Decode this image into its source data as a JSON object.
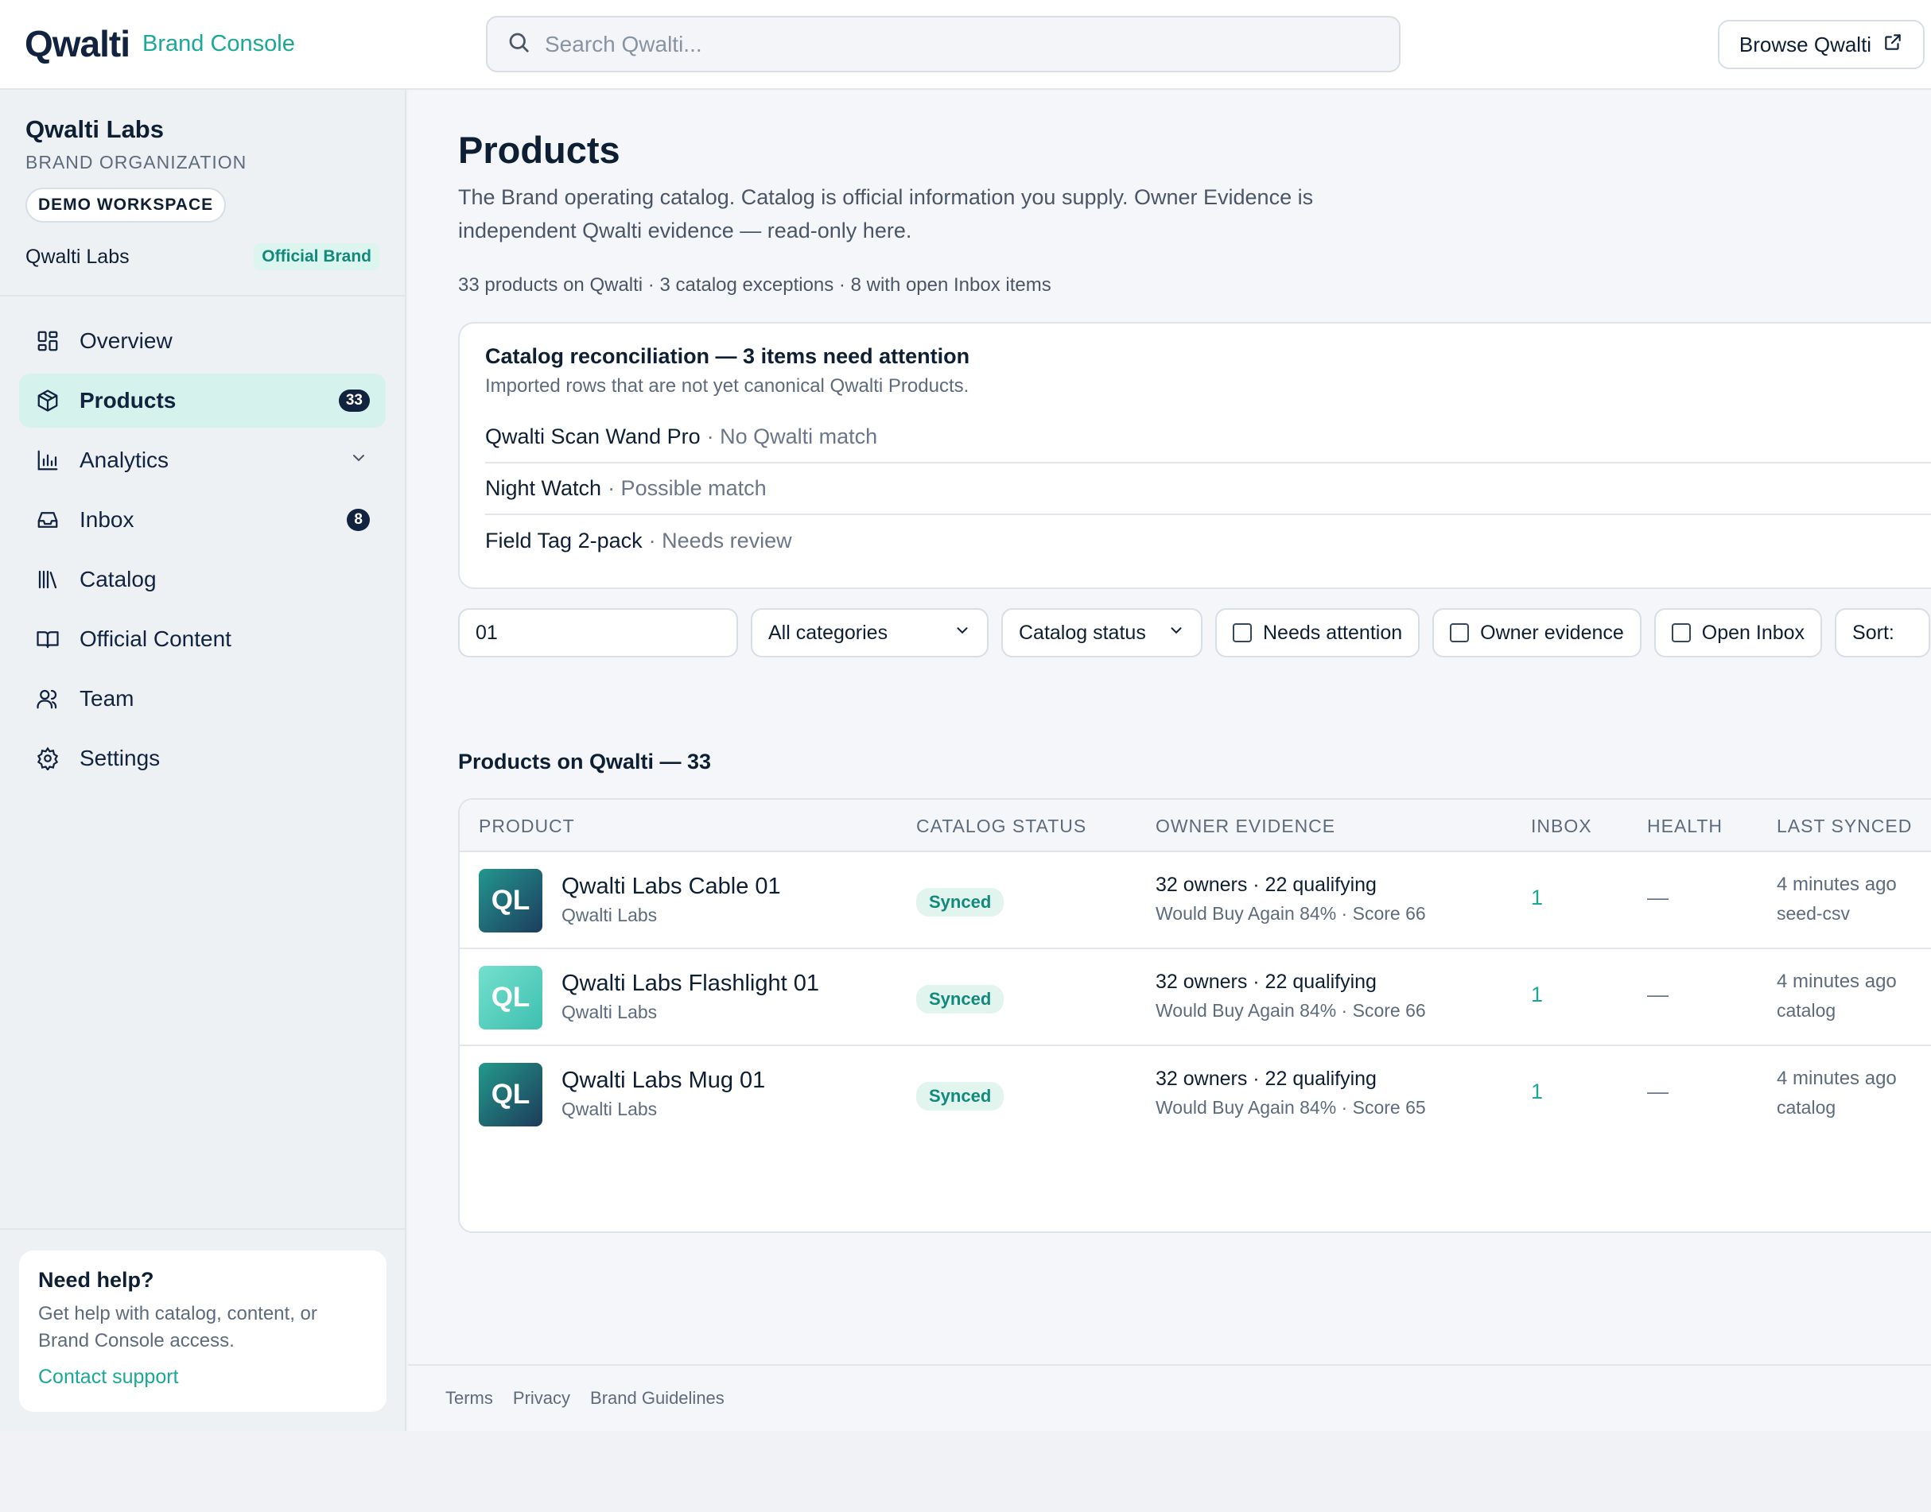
{
  "header": {
    "logo_text": "Qwalti",
    "subtitle": "Brand Console",
    "search_placeholder": "Search Qwalti...",
    "browse_label": "Browse Qwalti"
  },
  "sidebar": {
    "org_name": "Qwalti Labs",
    "org_type": "BRAND ORGANIZATION",
    "workspace_badge": "DEMO WORKSPACE",
    "brand_name": "Qwalti Labs",
    "brand_badge": "Official Brand",
    "items": [
      {
        "label": "Overview",
        "icon": "grid-icon"
      },
      {
        "label": "Products",
        "icon": "box-icon",
        "badge": "33",
        "active": true
      },
      {
        "label": "Analytics",
        "icon": "bar-chart-icon",
        "expandable": true
      },
      {
        "label": "Inbox",
        "icon": "inbox-icon",
        "badge": "8"
      },
      {
        "label": "Catalog",
        "icon": "library-icon"
      },
      {
        "label": "Official Content",
        "icon": "book-icon"
      },
      {
        "label": "Team",
        "icon": "users-icon"
      },
      {
        "label": "Settings",
        "icon": "gear-icon"
      }
    ],
    "help": {
      "title": "Need help?",
      "text": "Get help with catalog, content, or Brand Console access.",
      "link": "Contact support"
    }
  },
  "main": {
    "title": "Products",
    "description": "The Brand operating catalog. Catalog is official information you supply. Owner Evidence is independent Qwalti evidence — read-only here.",
    "meta": "33 products on Qwalti · 3 catalog exceptions · 8 with open Inbox items",
    "reconciliation": {
      "title": "Catalog reconciliation — 3 items need attention",
      "subtitle": "Imported rows that are not yet canonical Qwalti Products.",
      "items": [
        {
          "name": "Qwalti Scan Wand Pro",
          "status": "· No Qwalti match"
        },
        {
          "name": "Night Watch",
          "status": "· Possible match"
        },
        {
          "name": "Field Tag 2-pack",
          "status": "· Needs review"
        }
      ]
    },
    "filters": {
      "search_value": "01",
      "category": "All categories",
      "status": "Catalog status",
      "needs_attention": "Needs attention",
      "owner_evidence": "Owner evidence",
      "open_inbox": "Open Inbox",
      "sort": "Sort:"
    },
    "list_title": "Products on Qwalti — 33",
    "table": {
      "headers": [
        "PRODUCT",
        "CATALOG STATUS",
        "OWNER EVIDENCE",
        "INBOX",
        "HEALTH",
        "LAST SYNCED"
      ],
      "rows": [
        {
          "initials": "QL",
          "name": "Qwalti Labs Cable 01",
          "brand": "Qwalti Labs",
          "status": "Synced",
          "evidence": "32 owners · 22 qualifying",
          "evidence_detail": "Would Buy Again 84% · Score 66",
          "inbox": "1",
          "health": "—",
          "synced": "4 minutes ago",
          "source": "seed-csv",
          "thumb_color": "#1f8a86"
        },
        {
          "initials": "QL",
          "name": "Qwalti Labs Flashlight 01",
          "brand": "Qwalti Labs",
          "status": "Synced",
          "evidence": "32 owners · 22 qualifying",
          "evidence_detail": "Would Buy Again 84% · Score 66",
          "inbox": "1",
          "health": "—",
          "synced": "4 minutes ago",
          "source": "catalog",
          "thumb_color": "#5fd3c1"
        },
        {
          "initials": "QL",
          "name": "Qwalti Labs Mug 01",
          "brand": "Qwalti Labs",
          "status": "Synced",
          "evidence": "32 owners · 22 qualifying",
          "evidence_detail": "Would Buy Again 84% · Score 65",
          "inbox": "1",
          "health": "—",
          "synced": "4 minutes ago",
          "source": "catalog",
          "thumb_color": "#1f7a7f"
        }
      ]
    }
  },
  "footer": {
    "links": [
      "Terms",
      "Privacy",
      "Brand Guidelines"
    ]
  },
  "colors": {
    "accent": "#1aa897",
    "navy": "#12233f",
    "active_bg": "#d6f2ec"
  }
}
